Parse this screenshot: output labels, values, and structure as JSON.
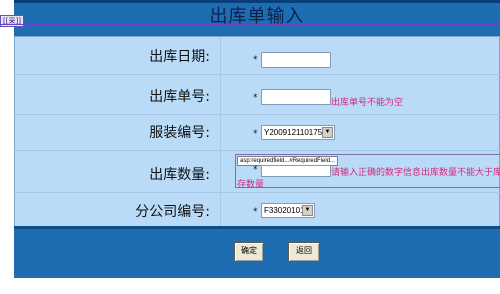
{
  "page": {
    "title": "出库单输入",
    "design_marker": "[[采]]"
  },
  "form": {
    "rows": [
      {
        "label": "出库日期:",
        "required": "*",
        "input_value": ""
      },
      {
        "label": "出库单号:",
        "required": "*",
        "input_value": "",
        "error": "出库单号不能为空"
      },
      {
        "label": "服装编号:",
        "required": "*",
        "select_value": "Y20091211017596"
      },
      {
        "label": "出库数量:",
        "required": "*",
        "validator": "asp:requiredfield...#RequiredField...",
        "input_value": "",
        "error_line1": "请输入正确的数字信息出库数量不能大于库",
        "error_line2": "存数量"
      },
      {
        "label": "分公司编号:",
        "required": "*",
        "select_value": "F33020101"
      }
    ]
  },
  "buttons": {
    "confirm": "确定",
    "back": "返回"
  },
  "colors": {
    "header_blue": "#1E6DB0",
    "form_bg": "#B9DBF8",
    "error_text": "#D6287A"
  }
}
